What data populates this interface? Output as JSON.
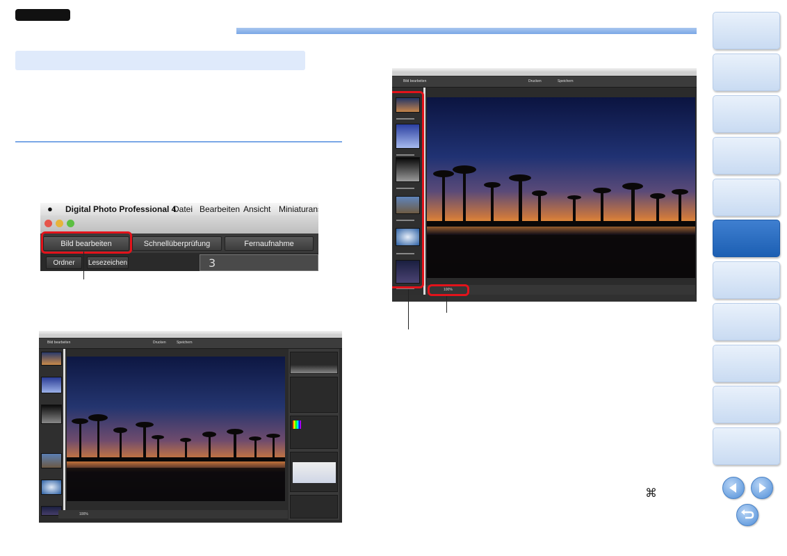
{
  "menu": {
    "app_title": "Digital Photo Professional 4",
    "items": [
      "Datei",
      "Bearbeiten",
      "Ansicht",
      "Miniaturansic"
    ]
  },
  "tabs": {
    "edit_image": "Bild bearbeiten",
    "quick_check": "Schnellüberprüfung",
    "remote_capture": "Fernaufnahme"
  },
  "folder_tabs": {
    "folder": "Ordner",
    "bookmarks": "Lesezeichen"
  },
  "preview_number": "3",
  "small_window": {
    "mode_label": "Bild bearbeiten",
    "print_button": "Drucken",
    "save_button": "Speichern",
    "zoom_label": "100%"
  },
  "footer": {
    "command_symbol": "⌘"
  },
  "colors": {
    "accent_blue": "#7aa7e6",
    "highlight_red": "#e3131b",
    "nav_active": "#1c5fb3"
  },
  "nav": {
    "tab_count": 11,
    "active_index": 5
  }
}
